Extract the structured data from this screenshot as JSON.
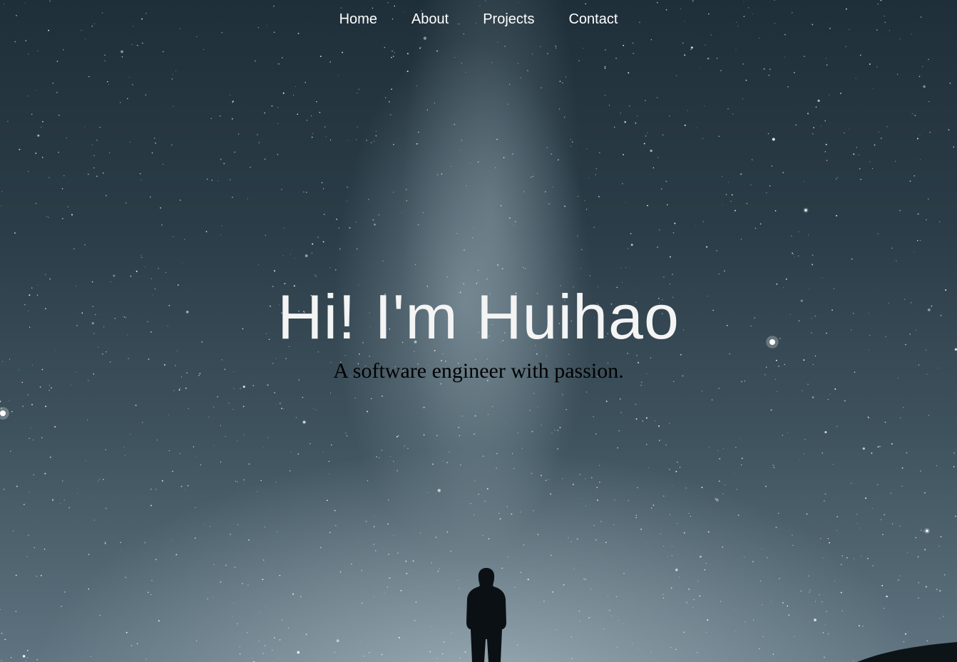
{
  "nav": {
    "items": [
      {
        "label": "Home"
      },
      {
        "label": "About"
      },
      {
        "label": "Projects"
      },
      {
        "label": "Contact"
      }
    ]
  },
  "hero": {
    "headline": "Hi! I'm Huihao",
    "tagline": "A software engineer with passion.",
    "background": "starry-night-sky-with-milky-way"
  },
  "colors": {
    "nav_text": "#ffffff",
    "headline_text": "#f4f4f4",
    "tagline_text": "#000000",
    "sky_dark": "#1f2f3a",
    "sky_light": "#5f7480"
  }
}
